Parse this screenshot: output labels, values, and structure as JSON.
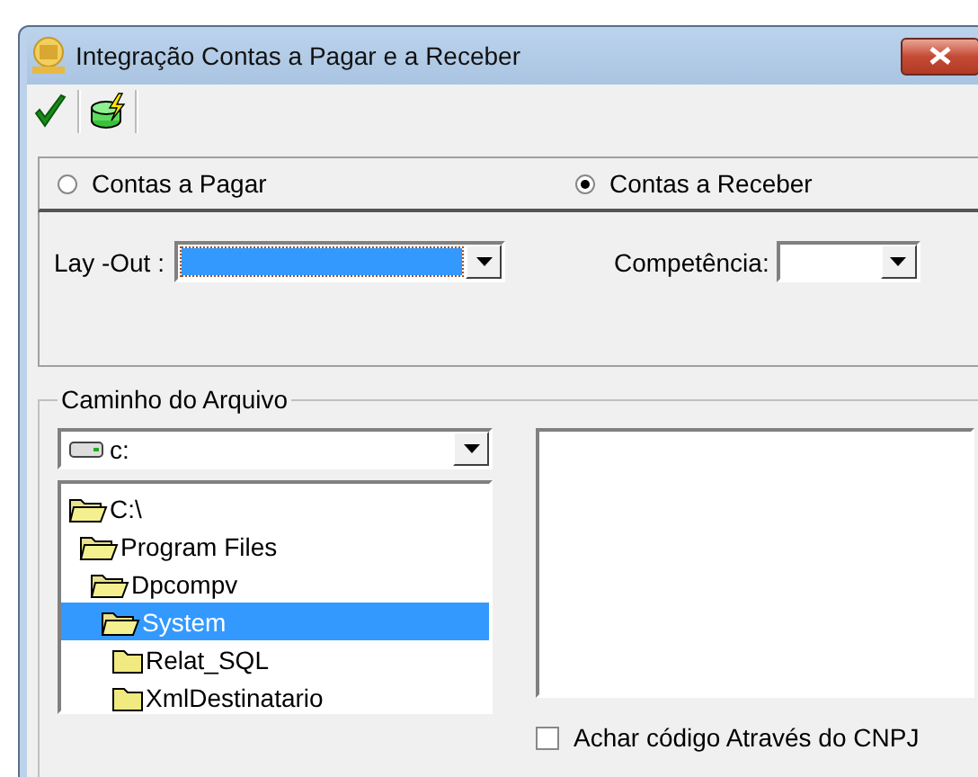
{
  "window": {
    "title": "Integração Contas a Pagar e a Receber"
  },
  "account_type": [
    {
      "label": "Contas a Pagar",
      "selected": false
    },
    {
      "label": "Contas a Receber",
      "selected": true
    }
  ],
  "layout_field": {
    "label": "Lay -Out :",
    "focused": true
  },
  "competencia_field": {
    "label": "Competência:"
  },
  "file_path": {
    "title": "Caminho do Arquivo",
    "drive": "c:",
    "tree": [
      {
        "name": "C:\\",
        "expanded": true,
        "selected": false,
        "children": [
          {
            "name": "Program Files",
            "expanded": true,
            "selected": false,
            "children": [
              {
                "name": "Dpcompv",
                "expanded": true,
                "selected": false,
                "children": [
                  {
                    "name": "System",
                    "expanded": true,
                    "selected": true,
                    "children": [
                      {
                        "name": "Relat_SQL",
                        "expanded": false,
                        "selected": false
                      },
                      {
                        "name": "XmlDestinatario",
                        "expanded": false,
                        "selected": false
                      }
                    ]
                  }
                ]
              }
            ]
          }
        ]
      }
    ]
  },
  "find_by_cnpj": {
    "label": "Achar código Através do CNPJ",
    "checked": false
  }
}
